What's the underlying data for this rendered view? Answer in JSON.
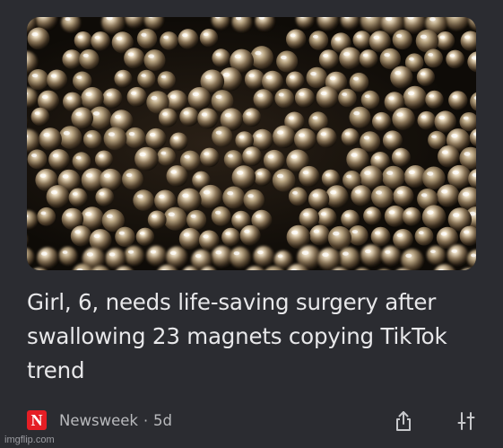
{
  "article": {
    "headline": "Girl, 6, needs life-saving surgery after swallowing 23 magnets copying TikTok trend",
    "source_logo": "N",
    "source": "Newsweek",
    "separator": "·",
    "age": "5d",
    "image_subject": "metallic magnetic balls"
  },
  "actions": {
    "share_icon": "share-icon",
    "tune_icon": "tune-icon"
  },
  "watermark": "imgflip.com",
  "colors": {
    "background": "#2b2c31",
    "text": "#e8e8ea",
    "muted": "#b9babd",
    "brand": "#e51e25"
  }
}
